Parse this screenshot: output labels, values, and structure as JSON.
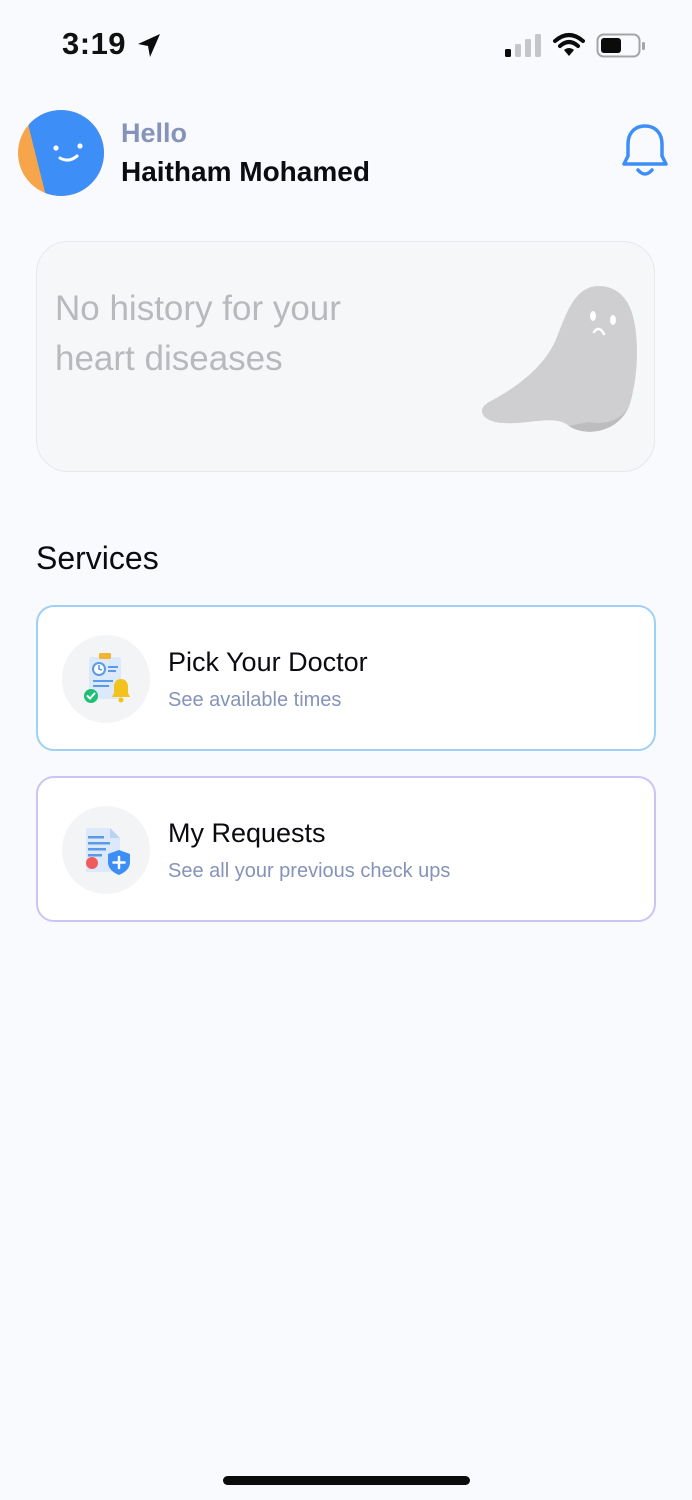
{
  "status_bar": {
    "time": "3:19"
  },
  "header": {
    "greeting": "Hello",
    "name": "Haitham Mohamed"
  },
  "history": {
    "message": "No history for your heart diseases"
  },
  "services": {
    "title": "Services",
    "items": [
      {
        "title": "Pick Your Doctor",
        "subtitle": "See available times"
      },
      {
        "title": "My Requests",
        "subtitle": "See all your previous check ups"
      }
    ]
  },
  "colors": {
    "accent": "#3e8ef7",
    "greeting": "#8593b8",
    "doctor_border": "#9fd0f6",
    "requests_border": "#cdc4f6",
    "history_text": "#b7b9bd"
  },
  "icons": [
    "location-arrow-icon",
    "cellular-signal-icon",
    "wifi-icon",
    "battery-icon",
    "bell-icon",
    "ghost-illustration",
    "doctor-schedule-icon",
    "requests-document-icon"
  ]
}
